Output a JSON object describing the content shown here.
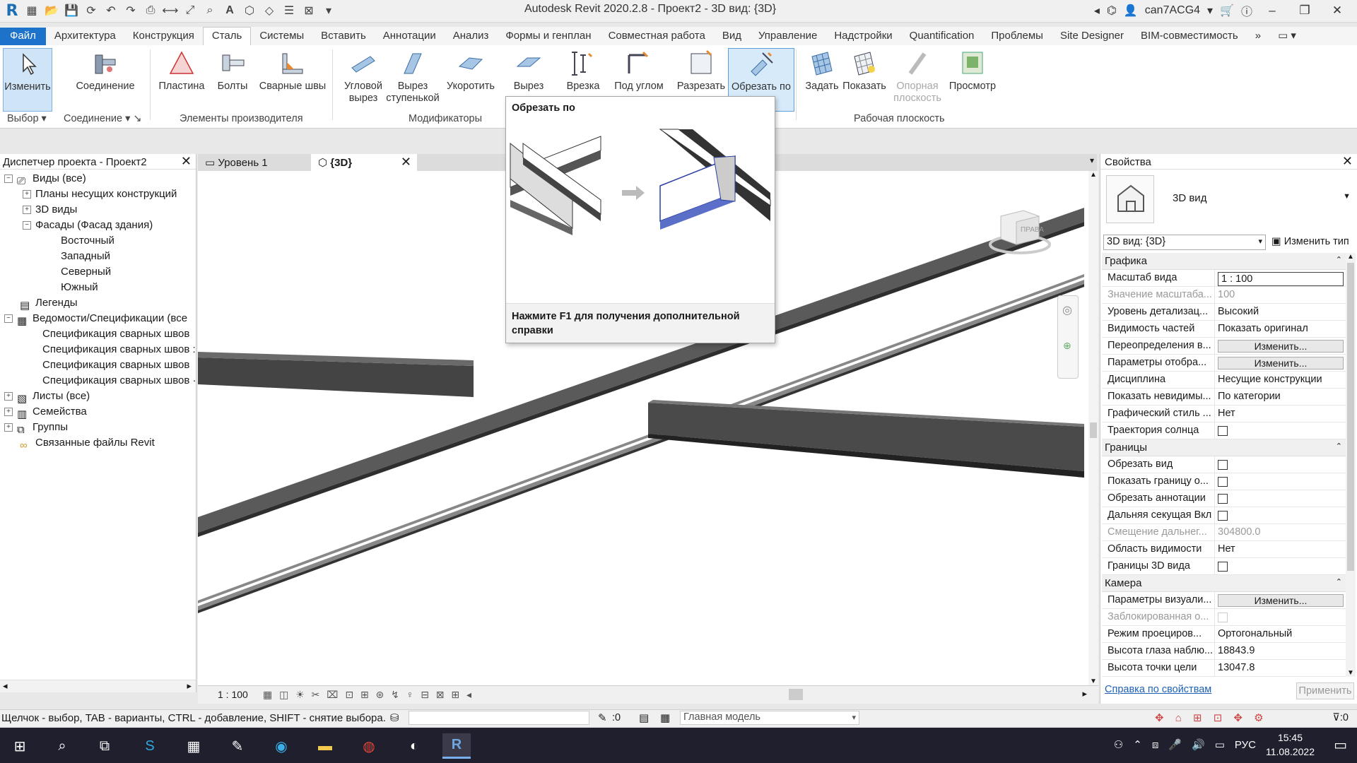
{
  "window": {
    "title": "Autodesk Revit 2020.2.8 - Проект2 - 3D вид: {3D}",
    "user": "can7ACG4"
  },
  "ribbon_tabs": [
    "Файл",
    "Архитектура",
    "Конструкция",
    "Сталь",
    "Системы",
    "Вставить",
    "Аннотации",
    "Анализ",
    "Формы и генплан",
    "Совместная работа",
    "Вид",
    "Управление",
    "Надстройки",
    "Quantification",
    "Проблемы",
    "Site Designer",
    "BIM-совместимость"
  ],
  "active_tab": "Сталь",
  "ribbon": {
    "modify": "Изменить",
    "connection": "Соединение",
    "plate": "Пластина",
    "bolts": "Болты",
    "welds": "Сварные швы",
    "corner_notch": "Угловой вырез",
    "stepped_notch": "Вырез ступенькой",
    "shorten": "Укоротить",
    "cut": "Вырез",
    "cope": "Врезка",
    "miter": "Под углом",
    "split": "Разрезать",
    "cut_by": "Обрезать по",
    "set": "Задать",
    "show": "Показать",
    "ref_plane": "Опорная плоскость",
    "viewer": "Просмотр",
    "panel_select": "Выбор",
    "panel_connection": "Соединение",
    "panel_fab": "Элементы производителя",
    "panel_modifiers": "Модификаторы",
    "panel_workplane": "Рабочая плоскость"
  },
  "tooltip": {
    "title": "Обрезать по",
    "footer": "Нажмите F1 для получения дополнительной справки"
  },
  "browser": {
    "title": "Диспетчер проекта - Проект2",
    "nodes": [
      {
        "label": "Виды (все)",
        "toggle": "−"
      },
      {
        "label": "Планы несущих конструкций",
        "toggle": "+"
      },
      {
        "label": "3D виды",
        "toggle": "+"
      },
      {
        "label": "Фасады (Фасад здания)",
        "toggle": "−"
      },
      {
        "label": "Восточный"
      },
      {
        "label": "Западный"
      },
      {
        "label": "Северный"
      },
      {
        "label": "Южный"
      },
      {
        "label": "Легенды"
      },
      {
        "label": "Ведомости/Спецификации (все",
        "toggle": "−"
      },
      {
        "label": "Спецификация сварных швов"
      },
      {
        "label": "Спецификация сварных швов :"
      },
      {
        "label": "Спецификация сварных швов"
      },
      {
        "label": "Спецификация сварных швов ·"
      },
      {
        "label": "Листы (все)",
        "toggle": "+"
      },
      {
        "label": "Семейства",
        "toggle": "+"
      },
      {
        "label": "Группы",
        "toggle": "+"
      },
      {
        "label": "Связанные файлы Revit"
      }
    ]
  },
  "view_tabs": {
    "level1": "Уровень 1",
    "view3d": "{3D}"
  },
  "viewcube": {
    "face": "ПРАВА"
  },
  "view_bar": {
    "scale": "1 : 100"
  },
  "properties": {
    "title": "Свойства",
    "type_name": "3D вид",
    "filter": "3D вид: {3D}",
    "edit_type": "Изменить тип",
    "groups": [
      {
        "name": "Графика",
        "rows": [
          {
            "name": "Масштаб вида",
            "value": "1 : 100",
            "kind": "input"
          },
          {
            "name": "Значение масштаба...",
            "value": "100",
            "kind": "dim"
          },
          {
            "name": "Уровень детализац...",
            "value": "Высокий"
          },
          {
            "name": "Видимость частей",
            "value": "Показать оригинал"
          },
          {
            "name": "Переопределения в...",
            "value": "Изменить...",
            "kind": "button"
          },
          {
            "name": "Параметры отобра...",
            "value": "Изменить...",
            "kind": "button"
          },
          {
            "name": "Дисциплина",
            "value": "Несущие конструкции"
          },
          {
            "name": "Показать невидимы...",
            "value": "По категории"
          },
          {
            "name": "Графический стиль ...",
            "value": "Нет"
          },
          {
            "name": "Траектория солнца",
            "value": "",
            "kind": "check"
          }
        ]
      },
      {
        "name": "Границы",
        "rows": [
          {
            "name": "Обрезать вид",
            "value": "",
            "kind": "check"
          },
          {
            "name": "Показать границу о...",
            "value": "",
            "kind": "check"
          },
          {
            "name": "Обрезать аннотации",
            "value": "",
            "kind": "check"
          },
          {
            "name": "Дальняя секущая Вкл",
            "value": "",
            "kind": "check"
          },
          {
            "name": "Смещение дальнег...",
            "value": "304800.0",
            "kind": "dim"
          },
          {
            "name": "Область видимости",
            "value": "Нет"
          },
          {
            "name": "Границы 3D вида",
            "value": "",
            "kind": "check"
          }
        ]
      },
      {
        "name": "Камера",
        "rows": [
          {
            "name": "Параметры визуали...",
            "value": "Изменить...",
            "kind": "button"
          },
          {
            "name": "Заблокированная о...",
            "value": "",
            "kind": "dimcheck"
          },
          {
            "name": "Режим проециров...",
            "value": "Ортогональный"
          },
          {
            "name": "Высота глаза наблю...",
            "value": "18843.9"
          },
          {
            "name": "Высота точки цели",
            "value": "13047.8"
          }
        ]
      }
    ],
    "help_link": "Справка по свойствам",
    "apply": "Применить"
  },
  "status": {
    "hint": "Щелчок - выбор, TAB - варианты, CTRL - добавление, SHIFT - снятие выбора.",
    "count": ":0",
    "model": "Главная модель",
    "filter_count": ":0"
  },
  "taskbar": {
    "lang": "РУС",
    "time": "15:45",
    "date": "11.08.2022"
  }
}
